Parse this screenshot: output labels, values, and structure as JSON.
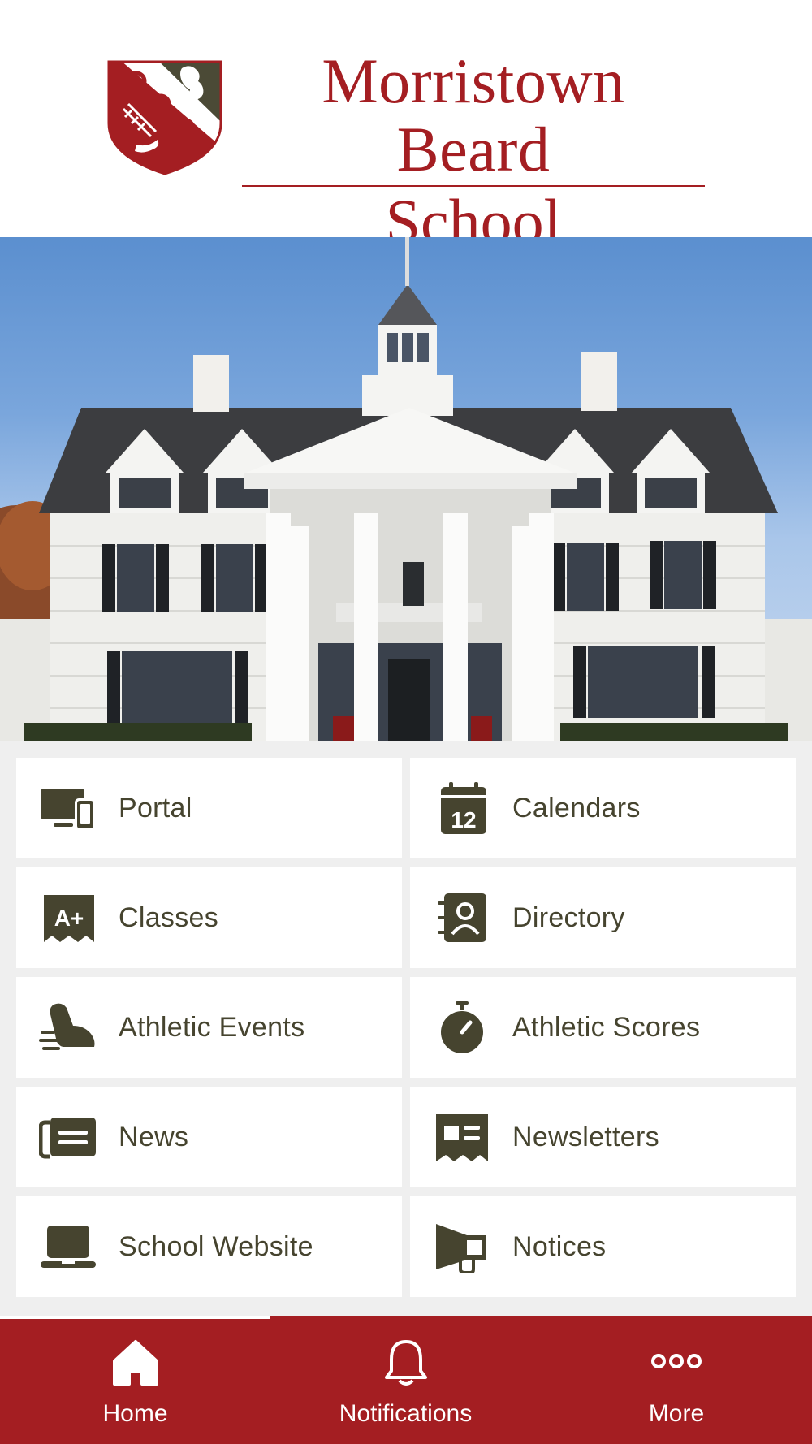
{
  "header": {
    "school_name_line1": "Morristown Beard",
    "school_name_line2": "School"
  },
  "colors": {
    "brand_red": "#a41e22",
    "icon_olive": "#46442f",
    "grid_background": "#efefef"
  },
  "tiles": [
    {
      "label": "Portal",
      "icon": "devices-icon"
    },
    {
      "label": "Calendars",
      "icon": "calendar-icon",
      "icon_text": "12"
    },
    {
      "label": "Classes",
      "icon": "grade-a-plus-icon",
      "icon_text": "A+"
    },
    {
      "label": "Directory",
      "icon": "contact-book-icon"
    },
    {
      "label": "Athletic Events",
      "icon": "running-shoe-icon"
    },
    {
      "label": "Athletic Scores",
      "icon": "stopwatch-icon"
    },
    {
      "label": "News",
      "icon": "newspaper-icon"
    },
    {
      "label": "Newsletters",
      "icon": "newsletter-icon"
    },
    {
      "label": "School Website",
      "icon": "laptop-icon"
    },
    {
      "label": "Notices",
      "icon": "megaphone-icon"
    }
  ],
  "tabbar": {
    "active": "Home",
    "tabs": [
      {
        "label": "Home",
        "icon": "home-icon"
      },
      {
        "label": "Notifications",
        "icon": "bell-icon"
      },
      {
        "label": "More",
        "icon": "more-dots-icon"
      }
    ]
  }
}
